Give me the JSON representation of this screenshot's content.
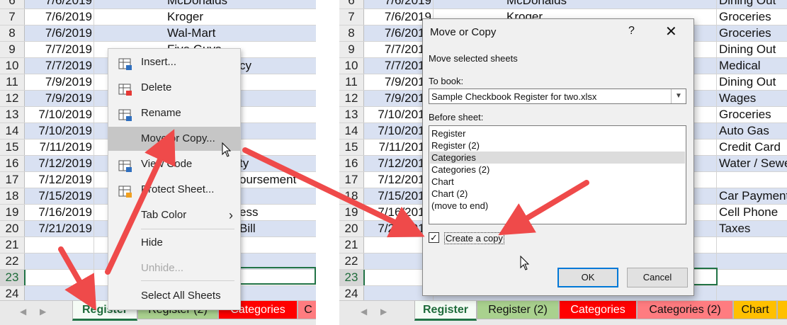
{
  "left": {
    "rows": [
      {
        "num": "6",
        "date": "7/6/2019",
        "payee": "McDonalds",
        "band": true
      },
      {
        "num": "7",
        "date": "7/6/2019",
        "payee": "Kroger",
        "band": false
      },
      {
        "num": "8",
        "date": "7/6/2019",
        "payee": "Wal-Mart",
        "band": true
      },
      {
        "num": "9",
        "date": "7/7/2019",
        "payee": "Five Guys",
        "band": false
      },
      {
        "num": "10",
        "date": "7/7/2019",
        "payee": "",
        "extra": "cy",
        "band": true
      },
      {
        "num": "11",
        "date": "7/9/2019",
        "payee": "",
        "band": false
      },
      {
        "num": "12",
        "date": "7/9/2019",
        "payee": "",
        "band": true
      },
      {
        "num": "13",
        "date": "7/10/2019",
        "payee": "",
        "band": false
      },
      {
        "num": "14",
        "date": "7/10/2019",
        "payee": "",
        "band": true
      },
      {
        "num": "15",
        "date": "7/11/2019",
        "payee": "",
        "band": false
      },
      {
        "num": "16",
        "date": "7/12/2019",
        "payee": "",
        "extra": "ty",
        "band": true
      },
      {
        "num": "17",
        "date": "7/12/2019",
        "payee": "",
        "extra": "oursement",
        "band": false
      },
      {
        "num": "18",
        "date": "7/15/2019",
        "payee": "",
        "band": true
      },
      {
        "num": "19",
        "date": "7/16/2019",
        "payee": "",
        "extra": "ess",
        "band": false
      },
      {
        "num": "20",
        "date": "7/21/2019",
        "payee": "",
        "extra": "Bill",
        "band": true
      },
      {
        "num": "21",
        "date": "",
        "payee": "",
        "band": false
      },
      {
        "num": "22",
        "date": "",
        "payee": "",
        "band": true
      },
      {
        "num": "23",
        "date": "",
        "payee": "",
        "band": false
      },
      {
        "num": "24",
        "date": "",
        "payee": "",
        "band": true
      }
    ],
    "tabs": [
      {
        "label": "Register",
        "color": "#a9d18e",
        "active": true
      },
      {
        "label": "Register (2)",
        "color": "#a9d18e",
        "active": false
      },
      {
        "label": "Categories",
        "color": "#ff0000",
        "active": false
      },
      {
        "label": "C",
        "color": "#ff7c80",
        "active": false
      }
    ]
  },
  "context_menu": {
    "items": [
      {
        "label": "Insert...",
        "icon": "insert-icon"
      },
      {
        "label": "Delete",
        "icon": "delete-sheet-icon"
      },
      {
        "label": "Rename",
        "icon": "rename-icon"
      },
      {
        "label": "Move or Copy...",
        "icon": "",
        "hover": true
      },
      {
        "label": "View Code",
        "icon": "view-code-icon"
      },
      {
        "label": "Protect Sheet...",
        "icon": "protect-sheet-icon"
      },
      {
        "label": "Tab Color",
        "icon": "",
        "submenu": true
      },
      {
        "label": "Hide",
        "icon": ""
      },
      {
        "label": "Unhide...",
        "icon": "",
        "disabled": true
      },
      {
        "label": "Select All Sheets",
        "icon": ""
      }
    ],
    "submenu_glyph": "›"
  },
  "right": {
    "rows": [
      {
        "num": "6",
        "date": "7/6/2019",
        "payee": "McDonalds",
        "category": "Dining Out",
        "band": true
      },
      {
        "num": "7",
        "date": "7/6/2019",
        "payee": "Kroger",
        "category": "Groceries",
        "band": false
      },
      {
        "num": "8",
        "date": "7/6/2019",
        "payee": "",
        "category": "Groceries",
        "band": true
      },
      {
        "num": "9",
        "date": "7/7/2019",
        "payee": "",
        "category": "Dining Out",
        "band": false
      },
      {
        "num": "10",
        "date": "7/7/2019",
        "payee": "",
        "category": "Medical",
        "band": true
      },
      {
        "num": "11",
        "date": "7/9/2019",
        "payee": "",
        "category": "Dining Out",
        "band": false
      },
      {
        "num": "12",
        "date": "7/9/2019",
        "payee": "",
        "category": "Wages",
        "band": true
      },
      {
        "num": "13",
        "date": "7/10/2019",
        "payee": "",
        "category": "Groceries",
        "band": false
      },
      {
        "num": "14",
        "date": "7/10/2019",
        "payee": "",
        "category": "Auto Gas",
        "band": true
      },
      {
        "num": "15",
        "date": "7/11/2019",
        "payee": "",
        "category": "Credit Card",
        "band": false
      },
      {
        "num": "16",
        "date": "7/12/2019",
        "payee": "",
        "category": "Water / Sewer",
        "band": true
      },
      {
        "num": "17",
        "date": "7/12/2019",
        "payee": "",
        "category": "",
        "band": false
      },
      {
        "num": "18",
        "date": "7/15/2019",
        "payee": "",
        "category": "Car Payment",
        "band": true
      },
      {
        "num": "19",
        "date": "7/16/2019",
        "payee": "",
        "category": "Cell Phone",
        "band": false
      },
      {
        "num": "20",
        "date": "7/21/2019",
        "payee": "",
        "category": "Taxes",
        "band": true
      },
      {
        "num": "21",
        "date": "",
        "payee": "",
        "category": "",
        "band": false
      },
      {
        "num": "22",
        "date": "",
        "payee": "",
        "category": "",
        "band": true
      },
      {
        "num": "23",
        "date": "",
        "payee": "",
        "category": "",
        "band": false
      },
      {
        "num": "24",
        "date": "",
        "payee": "",
        "category": "",
        "band": true
      }
    ],
    "tabs": [
      {
        "label": "Register",
        "color": "#a9d18e",
        "active": true
      },
      {
        "label": "Register (2)",
        "color": "#a9d18e",
        "active": false
      },
      {
        "label": "Categories",
        "color": "#ff0000",
        "active": false
      },
      {
        "label": "Categories (2)",
        "color": "#ff7c80",
        "active": false
      },
      {
        "label": "Chart",
        "color": "#ffc000",
        "active": false
      },
      {
        "label": "",
        "color": "#ffc000",
        "active": false
      }
    ]
  },
  "dialog": {
    "title": "Move or Copy",
    "help": "?",
    "close": "✕",
    "move_selected": "Move selected sheets",
    "to_book_label": "To book:",
    "to_book_value": "Sample Checkbook Register for two.xlsx",
    "before_sheet_label": "Before sheet:",
    "sheets": [
      "Register",
      "Register (2)",
      "Categories",
      "Categories (2)",
      "Chart",
      "Chart (2)",
      "(move to end)"
    ],
    "selected_index": 2,
    "create_copy_label": "Create a copy",
    "create_copy_checked": true,
    "check_glyph": "✓",
    "ok_label": "OK",
    "cancel_label": "Cancel"
  },
  "colors": {
    "arrow": "#ef4a4a",
    "accent": "#217346"
  }
}
